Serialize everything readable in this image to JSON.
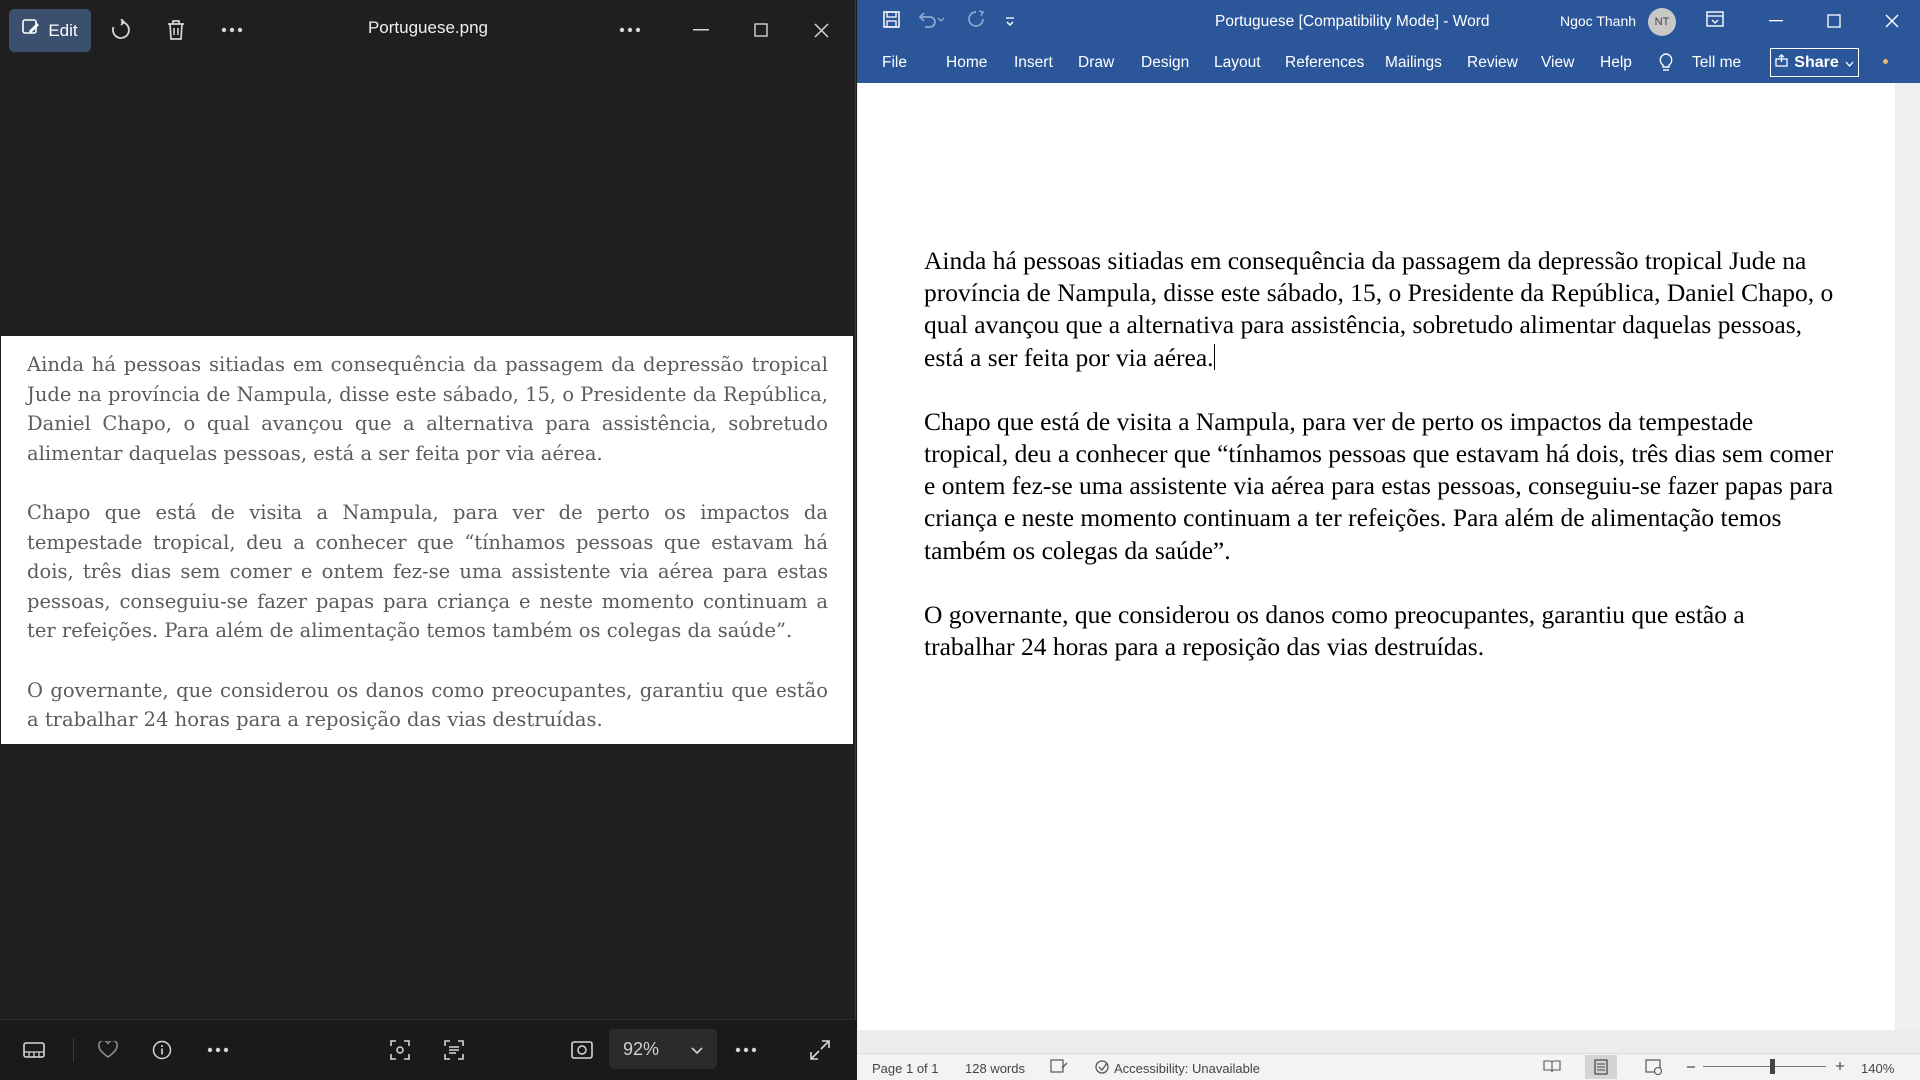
{
  "photos": {
    "edit_label": "Edit",
    "file_name": "Portuguese.png",
    "zoom_level": "92%",
    "paragraphs": [
      "Ainda há pessoas sitiadas em consequência da passagem da depressão tropical Jude na província de Nampula, disse este sábado, 15, o Presidente da República, Daniel Chapo, o qual avançou que a alternativa para assistência, sobretudo alimentar daquelas pessoas, está a ser feita por via aérea.",
      "Chapo que está de visita a Nampula, para ver de perto os impactos da tempestade tropical, deu a conhecer que “tínhamos pessoas que estavam há dois, três dias sem comer e ontem fez-se uma assistente via aérea para estas pessoas, conseguiu-se fazer papas para criança e neste momento continuam a ter refeições. Para além de alimentação temos também os colegas da saúde”.",
      "O governante, que considerou os danos como preocupantes, garantiu que estão a trabalhar 24 horas para a reposição das vias destruídas."
    ]
  },
  "word": {
    "title": "Portuguese [Compatibility Mode]  -  Word",
    "user_name": "Ngoc Thanh",
    "user_initials": "NT",
    "tabs": [
      "File",
      "Home",
      "Insert",
      "Draw",
      "Design",
      "Layout",
      "References",
      "Mailings",
      "Review",
      "View",
      "Help"
    ],
    "tell_me": "Tell me",
    "share_label": "Share",
    "paragraphs": [
      "Ainda há pessoas sitiadas em consequência da passagem da depressão tropical Jude na província de Nampula, disse este sábado, 15, o Presidente da República, Daniel Chapo, o qual avançou que a alternativa para assistência, sobretudo alimentar daquelas pessoas, está a ser feita por via aérea.",
      "Chapo que está de visita a Nampula, para ver de perto os impactos da tempestade tropical, deu a conhecer que “tínhamos pessoas que estavam há dois, três dias sem comer e ontem fez-se uma assistente via aérea para estas pessoas, conseguiu-se fazer papas para criança e neste momento continuam a ter refeições. Para além de alimentação temos também os colegas da saúde”.",
      "O governante, que considerou os danos como preocupantes, garantiu que estão a trabalhar 24 horas para a reposição das vias destruídas."
    ],
    "status": {
      "page": "Page 1 of 1",
      "words": "128 words",
      "accessibility": "Accessibility: Unavailable",
      "zoom": "140%"
    }
  },
  "colors": {
    "word_blue": "#2b579a",
    "photos_bg": "#1f1f1f",
    "edit_button": "#3b4f6e"
  },
  "icons": [
    "edit-icon",
    "rotate-icon",
    "delete-icon",
    "more-icon",
    "minimize-icon",
    "maximize-icon",
    "close-icon",
    "filmstrip-icon",
    "heart-icon",
    "info-icon",
    "crop-icon",
    "text-scan-icon",
    "fit-icon",
    "chevron-down-icon",
    "fullscreen-icon",
    "save-icon",
    "undo-icon",
    "redo-icon",
    "lightbulb-icon",
    "share-icon",
    "ribbon-display-icon"
  ]
}
